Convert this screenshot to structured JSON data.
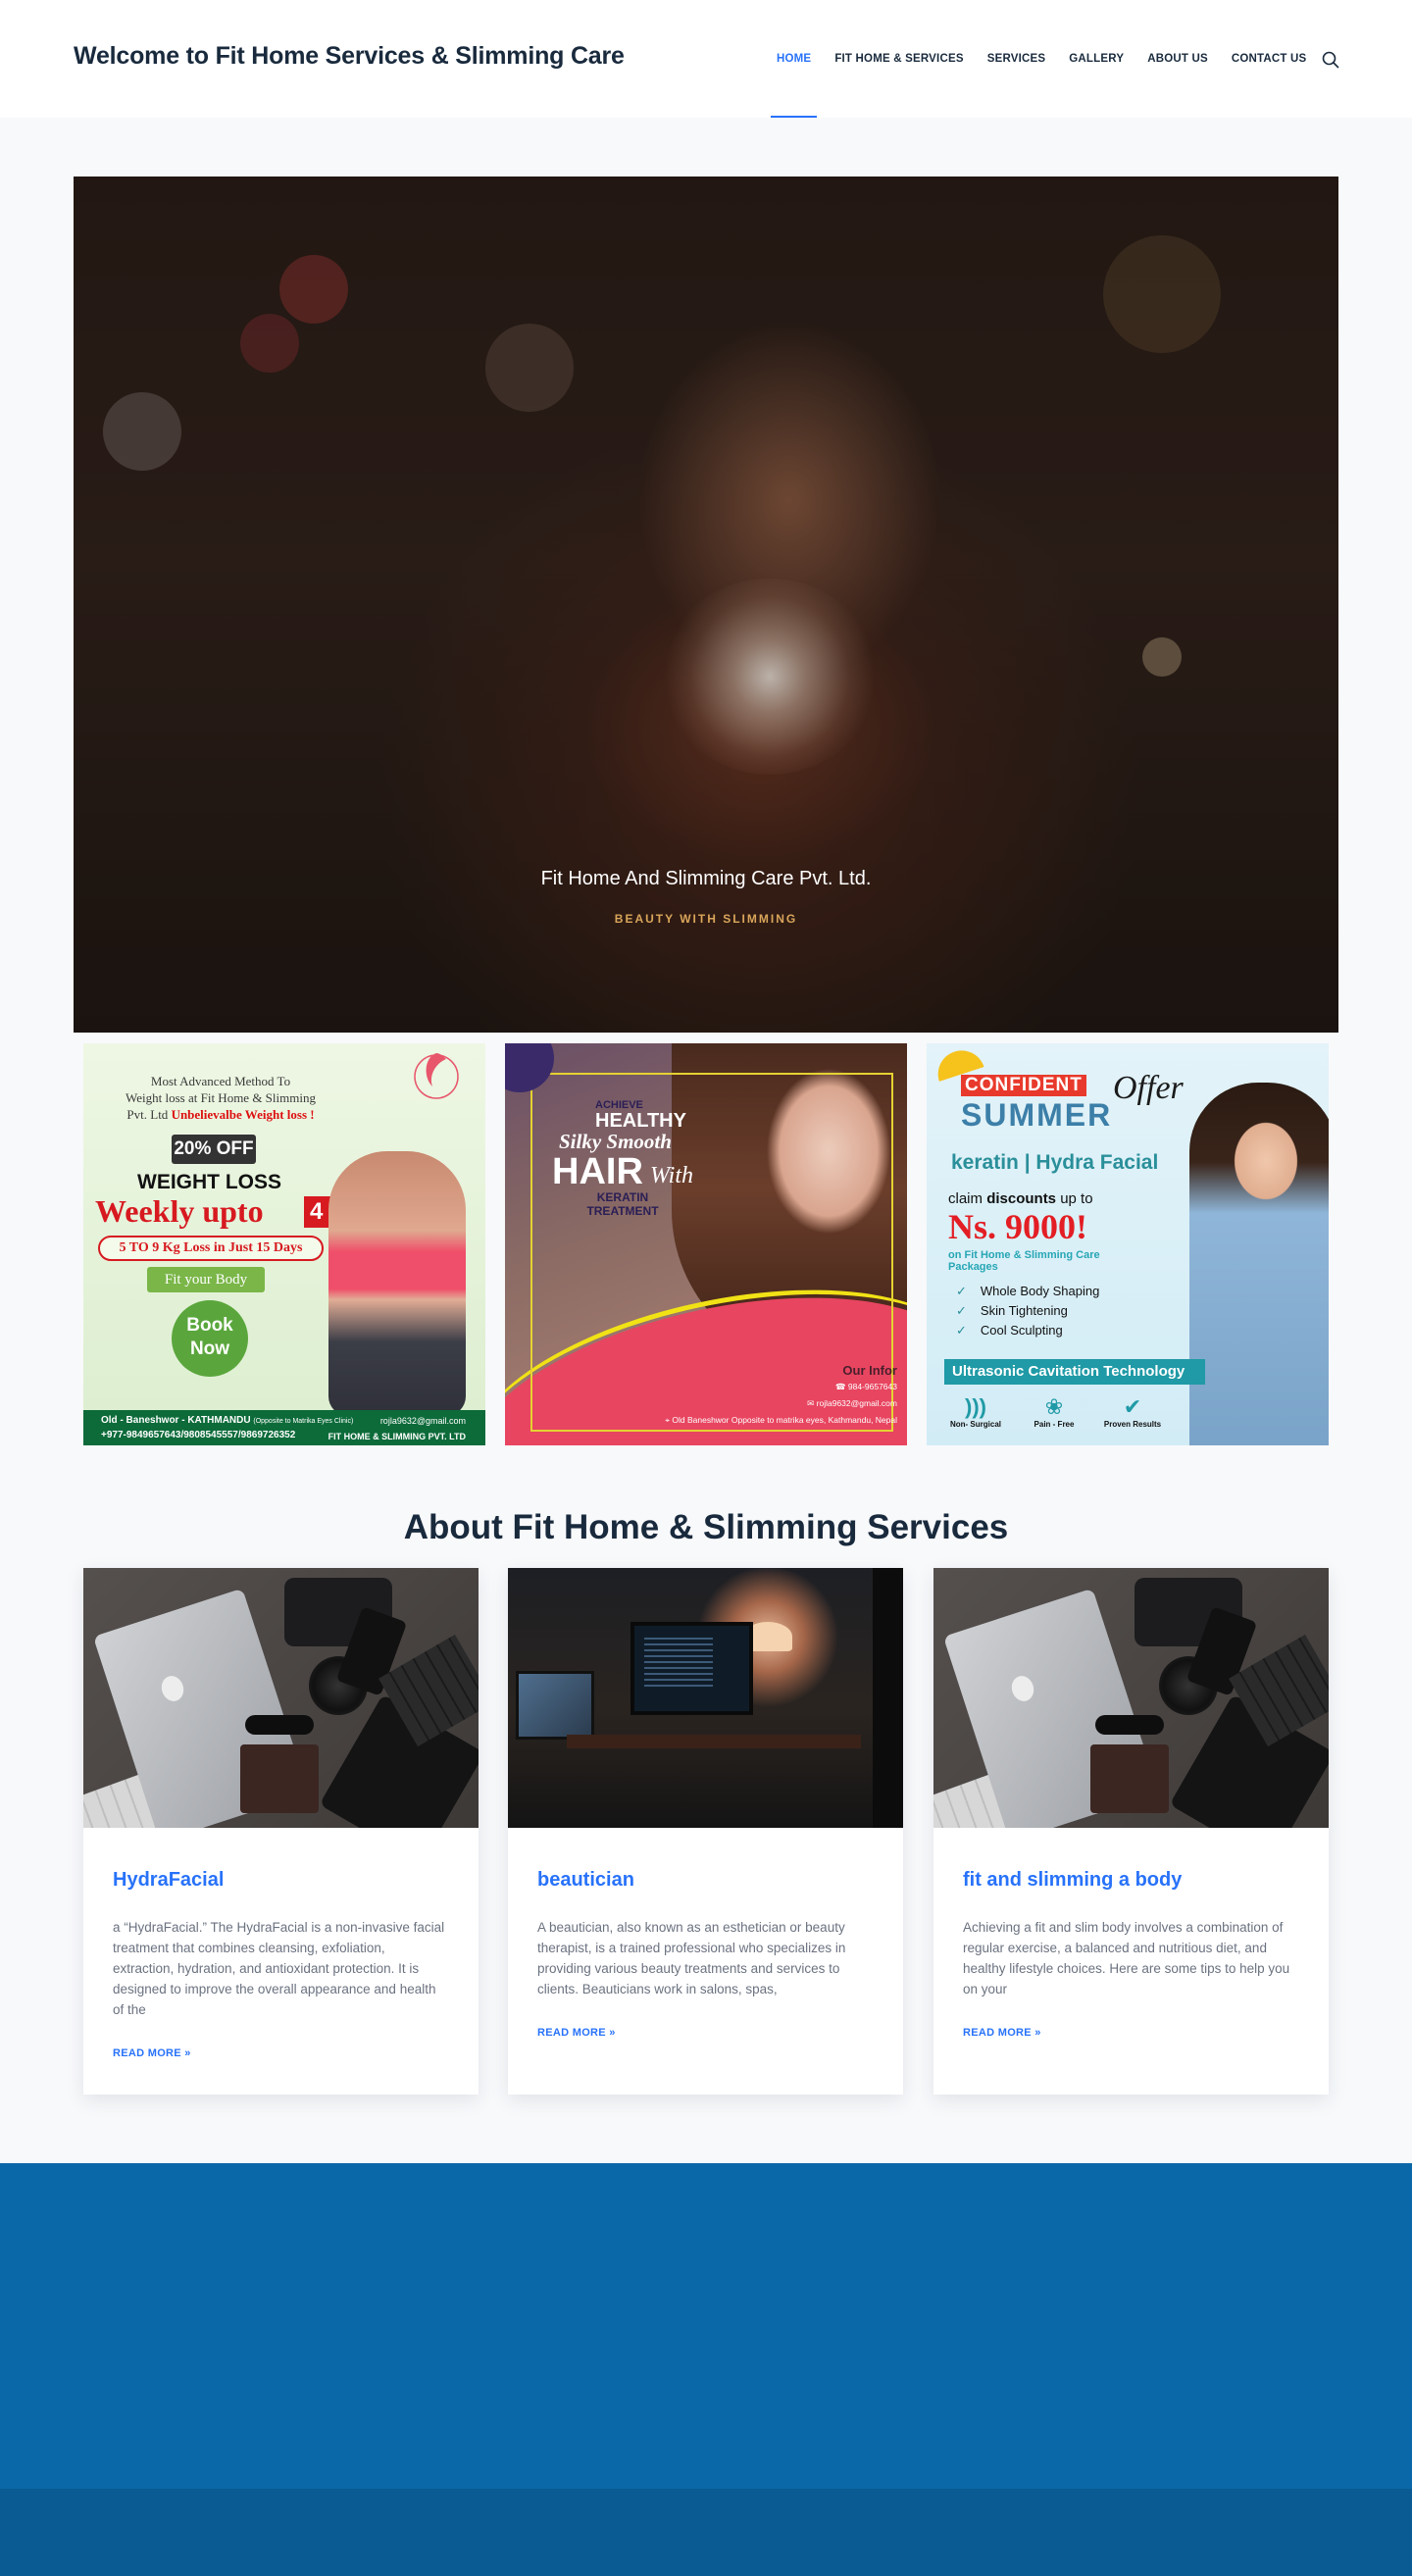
{
  "header": {
    "site_title": "Welcome to Fit Home Services & Slimming Care",
    "nav": [
      {
        "label": "HOME",
        "active": true
      },
      {
        "label": "FIT HOME & SERVICES",
        "active": false
      },
      {
        "label": "SERVICES",
        "active": false
      },
      {
        "label": "GALLERY",
        "active": false
      },
      {
        "label": "ABOUT US",
        "active": false
      },
      {
        "label": "CONTACT US",
        "active": false
      }
    ],
    "search_icon": "search-icon"
  },
  "hero": {
    "title": "Fit Home And Slimming Care Pvt. Ltd.",
    "subtitle": "BEAUTY WITH SLIMMING"
  },
  "promos": {
    "weight_loss": {
      "headline_line1": "Most Advanced Method To",
      "headline_line2": "Weight loss at Fit Home & Slimming",
      "headline_line3": "Pvt. Ltd",
      "headline_red": "Unbelievalbe Weight loss !",
      "discount": "20% OFF",
      "weight_loss_label": "WEIGHT LOSS",
      "weekly": "Weekly upto",
      "kg": "4 Kg",
      "loss_range": "5 TO 9 Kg Loss in Just 15 Days",
      "fit_body": "Fit your Body",
      "book": "Book",
      "now": "Now",
      "location": "Old - Baneshwor - KATHMANDU",
      "location_note": "(Opposite to Matrika Eyes Clinic)",
      "phones": "+977-9849657643/9808545557/9869726352",
      "email": "rojla9632@gmail.com",
      "company": "FIT HOME & SLIMMING PVT. LTD"
    },
    "keratin": {
      "achieve": "ACHIEVE",
      "healthy": "HEALTHY",
      "silky": "Silky Smooth",
      "hair": "HAIR",
      "with": "With",
      "keratin": "KERATIN TREATMENT",
      "our_info": "Our Infor",
      "phone": "984-9657643",
      "email": "rojla9632@gmail.com",
      "address": "Old Baneshwor Opposite to matrika eyes, Kathmandu, Nepal"
    },
    "summer": {
      "confident": "CONFIDENT",
      "offer": "Offer",
      "summer": "SUMMER",
      "services": "keratin | Hydra Facial",
      "claim_prefix": "claim",
      "claim_bold": "discounts",
      "claim_suffix": "up to",
      "amount": "Ns. 9000!",
      "packages": "on Fit Home & Slimming Care Packages",
      "features": [
        "Whole Body Shaping",
        "Skin Tightening",
        "Cool Sculpting"
      ],
      "technology": "Ultrasonic Cavitation Technology",
      "icon_labels": [
        "Non- Surgical",
        "Pain - Free",
        "Proven Results"
      ]
    }
  },
  "about": {
    "title": "About Fit Home & Slimming Services",
    "cards": [
      {
        "title": "HydraFacial",
        "text": "a “HydraFacial.” The HydraFacial is a non-invasive facial treatment that combines cleansing, exfoliation, extraction, hydration, and antioxidant protection. It is designed to improve the overall appearance and health of the",
        "more": "READ MORE »"
      },
      {
        "title": "beautician",
        "text": "A beautician, also known as an esthetician or beauty therapist, is a trained professional who specializes in providing various beauty treatments and services to clients. Beauticians work in salons, spas,",
        "more": "READ MORE »"
      },
      {
        "title": "fit and slimming a body",
        "text": "Achieving a fit and slim body involves a combination of regular exercise, a balanced and nutritious diet, and healthy lifestyle choices. Here are some tips to help you on your",
        "more": "READ MORE »"
      }
    ]
  },
  "colors": {
    "accent": "#2872fa",
    "heading": "#192a3d",
    "footer_top": "#0b68a8",
    "footer_bottom": "#0a5b93"
  }
}
